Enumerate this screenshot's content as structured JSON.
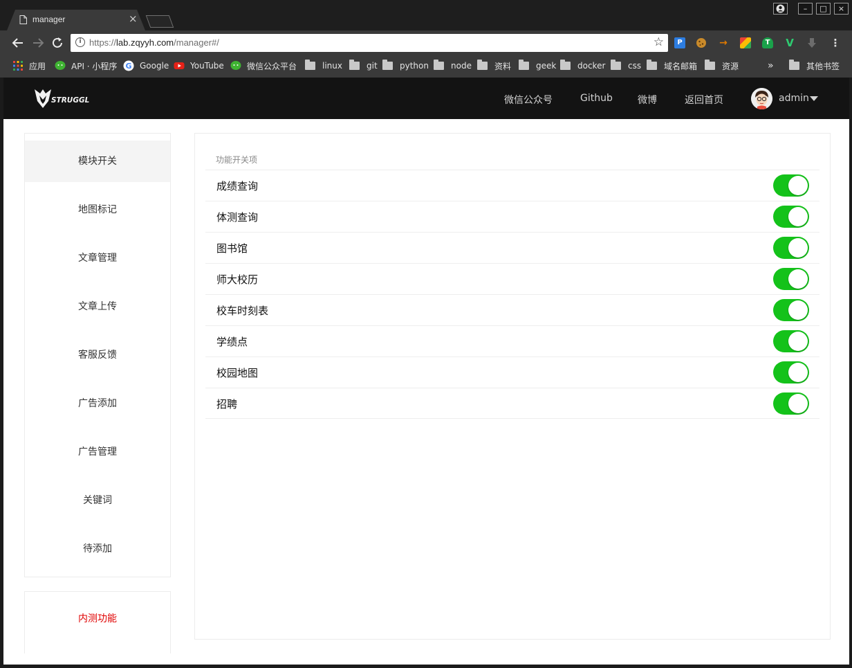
{
  "browser": {
    "tab_title": "manager",
    "tab_close": "×",
    "url_protocol": "https://",
    "url_host": "lab.zqyyh.com",
    "url_path": "/manager#/",
    "window_controls": {
      "minimize": "–",
      "maximize": "□",
      "close": "×"
    },
    "extensions": [
      {
        "name": "P",
        "color": "#2d7de0"
      },
      {
        "name": "",
        "color": "#c98a2a"
      },
      {
        "name": "→",
        "color": "#e07a00"
      },
      {
        "name": "",
        "color": "#4caf50"
      },
      {
        "name": "T",
        "color": "#1aa14a"
      },
      {
        "name": "V",
        "color": "#2ecc71"
      },
      {
        "name": "",
        "color": "#6c6c6c"
      }
    ],
    "bookmarks": [
      {
        "label": "应用",
        "icon": "apps-icon"
      },
      {
        "label": "API · 小程序",
        "icon": "wechat-icon"
      },
      {
        "label": "Google",
        "icon": "google-icon"
      },
      {
        "label": "YouTube",
        "icon": "youtube-icon"
      },
      {
        "label": "微信公众平台",
        "icon": "wechat-icon"
      },
      {
        "label": "linux",
        "icon": "folder-icon"
      },
      {
        "label": "git",
        "icon": "folder-icon"
      },
      {
        "label": "python",
        "icon": "folder-icon"
      },
      {
        "label": "node",
        "icon": "folder-icon"
      },
      {
        "label": "资料",
        "icon": "folder-icon"
      },
      {
        "label": "geek",
        "icon": "folder-icon"
      },
      {
        "label": "docker",
        "icon": "folder-icon"
      },
      {
        "label": "css",
        "icon": "folder-icon"
      },
      {
        "label": "域名邮箱",
        "icon": "folder-icon"
      },
      {
        "label": "资源",
        "icon": "folder-icon"
      }
    ],
    "bookmarks_overflow": "»",
    "other_bookmarks": "其他书签"
  },
  "header": {
    "logo_text": "STRUGGLE",
    "nav": [
      "微信公众号",
      "Github",
      "微博",
      "返回首页"
    ],
    "user": "admin"
  },
  "sidebar": {
    "items": [
      "模块开关",
      "地图标记",
      "文章管理",
      "文章上传",
      "客服反馈",
      "广告添加",
      "广告管理",
      "关键词",
      "待添加"
    ],
    "active_index": 0,
    "beta_label": "内测功能"
  },
  "content": {
    "section_title": "功能开关项",
    "switches": [
      {
        "label": "成绩查询",
        "on": true
      },
      {
        "label": "体测查询",
        "on": true
      },
      {
        "label": "图书馆",
        "on": true
      },
      {
        "label": "师大校历",
        "on": true
      },
      {
        "label": "校车时刻表",
        "on": true
      },
      {
        "label": "学绩点",
        "on": true
      },
      {
        "label": "校园地图",
        "on": true
      },
      {
        "label": "招聘",
        "on": true
      }
    ]
  },
  "colors": {
    "switch_on": "#14c21a",
    "beta_text": "#e00000",
    "header_bg": "#131313"
  }
}
